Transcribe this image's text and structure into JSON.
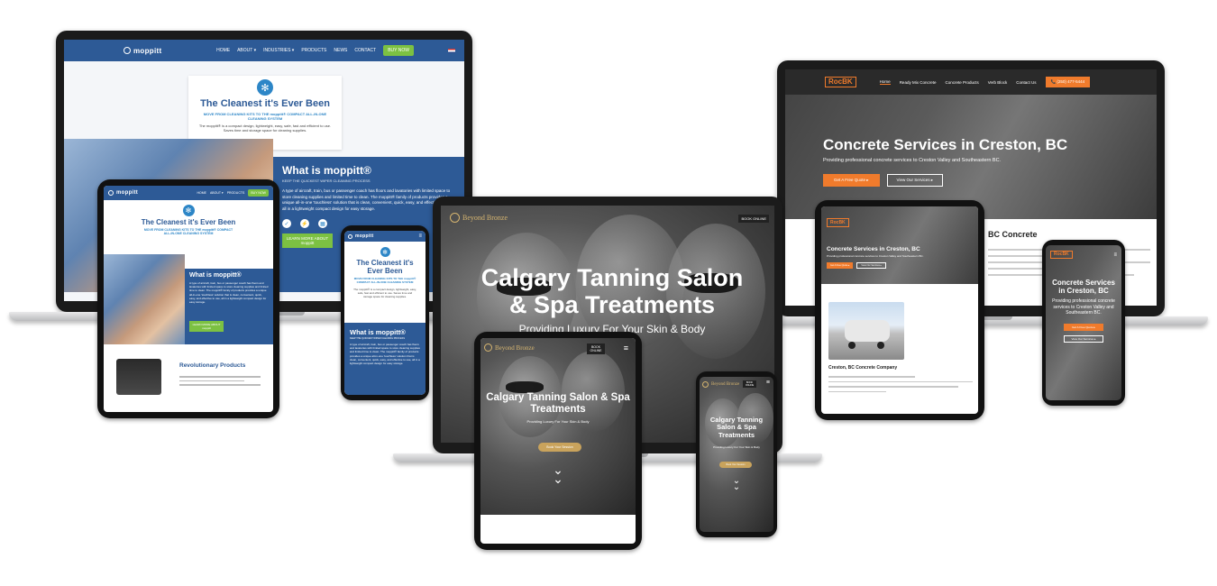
{
  "moppitt": {
    "logo": "moppitt",
    "nav": [
      "HOME",
      "ABOUT ▾",
      "INDUSTRIES ▾",
      "PRODUCTS",
      "NEWS",
      "CONTACT"
    ],
    "cta": "BUY NOW",
    "hero_title": "The Cleanest it's Ever Been",
    "hero_sub": "MOVE FROM CLEANING KITS TO THE moppitt® COMPACT ALL-IN-ONE CLEANING SYSTEM",
    "hero_body": "The moppitt® is a compact design, lightweight, easy, safe, fast and efficient to use. Saves time and storage space for cleaning supplies.",
    "what_title": "What is moppitt®",
    "what_sub": "KEEP THE QUICKEST WIPER CLEANING PROCESS",
    "what_body": "A type of aircraft, train, bus or passenger coach has floors and lavatories with limited space to store cleaning supplies and limited time to clean. The moppitt® family of products provides a unique all-in-one 'touchless' solution that is clean, convenient, quick, easy, and effective to use, all in a lightweight compact design for easy storage.",
    "features": [
      "SANITARY",
      "EFFICIENT",
      "STORAGE",
      "VERSATILE"
    ],
    "learn_btn": "LEARN MORE ABOUT moppitt",
    "products_title": "Revolutionary Products"
  },
  "rock": {
    "logo": "RocBK",
    "nav": [
      "Home",
      "Ready Mix Concrete",
      "Concrete Products",
      "Verb Block",
      "Contact Us"
    ],
    "phone": "📞 (250) 477-5444",
    "hero_title": "Concrete Services in Creston, BC",
    "hero_sub": "Providing professional concrete services to Creston Valley and Southeastern BC.",
    "btn_quote": "Get A Free Quote ▸",
    "btn_services": "View Our Services ▸",
    "section_title": "Creston, BC Concrete Company",
    "section_partial": "BC Concrete"
  },
  "bronze": {
    "logo": "Beyond Bronze",
    "book": "BOOK ONLINE",
    "hero_title": "Calgary Tanning Salon & Spa Treatments",
    "hero_sub": "Providing Luxury For Your Skin & Body",
    "btn": "Book Your Session"
  }
}
